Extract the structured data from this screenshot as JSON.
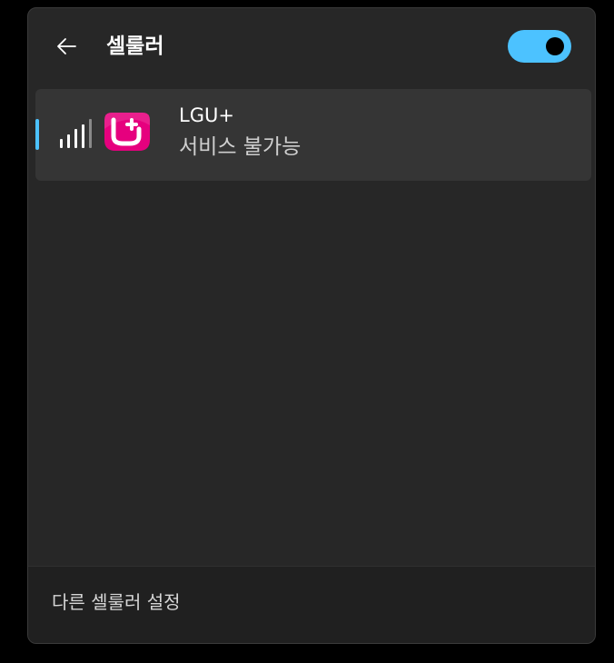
{
  "header": {
    "title": "셀룰러",
    "back_icon": "arrow-left-icon",
    "toggle_state": "on"
  },
  "networks": [
    {
      "carrier": "LGU+",
      "status": "서비스 불가능",
      "signal_icon": "signal-bars-icon",
      "logo": "lgu-plus-logo",
      "selected": true
    }
  ],
  "footer": {
    "link_label": "다른 셀룰러 설정"
  },
  "colors": {
    "accent": "#4cc2ff",
    "panel_bg": "#272727",
    "item_bg": "#353535",
    "footer_bg": "#202020",
    "logo_magenta": "#e6007e"
  }
}
